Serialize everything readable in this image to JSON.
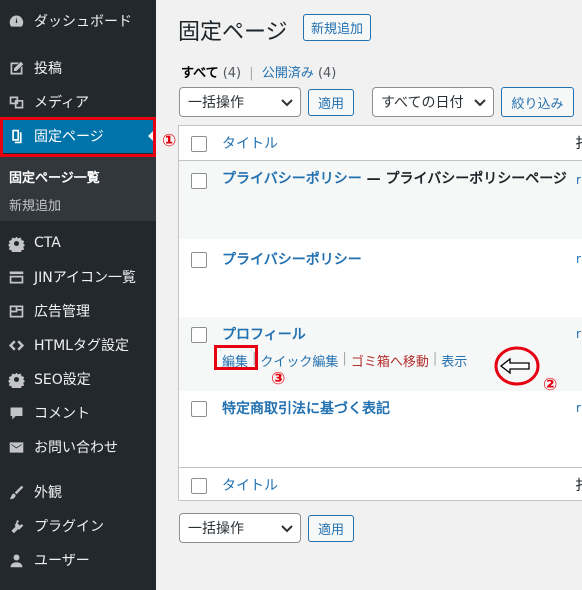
{
  "sidebar": {
    "items": [
      {
        "label": "ダッシュボード",
        "icon": "dashboard-icon"
      },
      {
        "label": "投稿",
        "icon": "pin-icon"
      },
      {
        "label": "メディア",
        "icon": "media-icon"
      },
      {
        "label": "固定ページ",
        "icon": "pages-icon"
      },
      {
        "label": "CTA",
        "icon": "gear-icon"
      },
      {
        "label": "JINアイコン一覧",
        "icon": "list-icon"
      },
      {
        "label": "広告管理",
        "icon": "ad-icon"
      },
      {
        "label": "HTMLタグ設定",
        "icon": "code-icon"
      },
      {
        "label": "SEO設定",
        "icon": "gear-icon"
      },
      {
        "label": "コメント",
        "icon": "comment-icon"
      },
      {
        "label": "お問い合わせ",
        "icon": "mail-icon"
      },
      {
        "label": "外観",
        "icon": "brush-icon"
      },
      {
        "label": "プラグイン",
        "icon": "plugin-icon"
      },
      {
        "label": "ユーザー",
        "icon": "user-icon"
      }
    ],
    "submenu": [
      "固定ページ一覧",
      "新規追加"
    ]
  },
  "header": {
    "title": "固定ページ",
    "add_new": "新規追加"
  },
  "filters": {
    "all": "すべて",
    "all_count": "(4)",
    "separator": "|",
    "published": "公開済み",
    "published_count": "(4)"
  },
  "bulk": {
    "select": "一括操作",
    "apply": "適用"
  },
  "date_filter": {
    "select": "すべての日付",
    "button": "絞り込み"
  },
  "table": {
    "header_title": "タイトル",
    "header_cut": "扌",
    "rows": [
      {
        "title": "プライバシーポリシー",
        "dash": " — ",
        "state": "プライバシーポリシーページ",
        "cut": "ri"
      },
      {
        "title": "プライバシーポリシー",
        "cut": "ri"
      },
      {
        "title": "プロフィール",
        "cut": "ri"
      },
      {
        "title": "特定商取引法に基づく表記",
        "cut": "ri"
      }
    ],
    "row_actions": {
      "edit": "編集",
      "quick_edit": "クイック編集",
      "trash": "ゴミ箱へ移動",
      "view": "表示"
    },
    "footer_title": "タイトル"
  },
  "annotations": {
    "one": "①",
    "two": "②",
    "three": "③"
  },
  "colors": {
    "sidebar_bg": "#23282d",
    "active_bg": "#0073aa",
    "link": "#2271b1",
    "annotation": "#e60012"
  }
}
